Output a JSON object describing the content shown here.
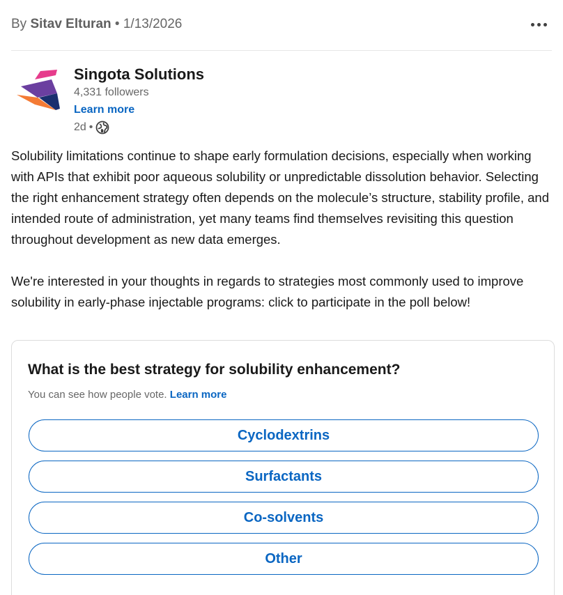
{
  "byline": {
    "prefix": "By",
    "author": "Sitav Elturan",
    "separator": "•",
    "date": "1/13/2026"
  },
  "company": {
    "name": "Singota Solutions",
    "followers": "4,331 followers",
    "learn_more": "Learn more",
    "age": "2d",
    "age_separator": "•",
    "visibility_icon": "globe-icon",
    "logo_colors": [
      "#e63c8c",
      "#6b3fa0",
      "#1a2f6e",
      "#f47b35"
    ]
  },
  "post": {
    "paragraphs": [
      "Solubility limitations continue to shape early formulation decisions, especially when working with APIs that exhibit poor aqueous solubility or unpredictable dissolution behavior. Selecting the right enhancement strategy often depends on the molecule’s structure, stability profile, and intended route of administration, yet many teams find themselves revisiting this question throughout development as new data emerges.",
      "We're interested in your thoughts in regards to strategies most commonly used to improve solubility in early-phase injectable programs: click to participate in the poll below!"
    ]
  },
  "poll": {
    "question": "What is the best strategy for solubility enhancement?",
    "note": "You can see how people vote.",
    "learn_more": "Learn more",
    "options": [
      "Cyclodextrins",
      "Surfactants",
      "Co-solvents",
      "Other"
    ]
  },
  "colors": {
    "accent": "#0a66c2",
    "muted_text": "#666666",
    "body_text": "#191919"
  }
}
